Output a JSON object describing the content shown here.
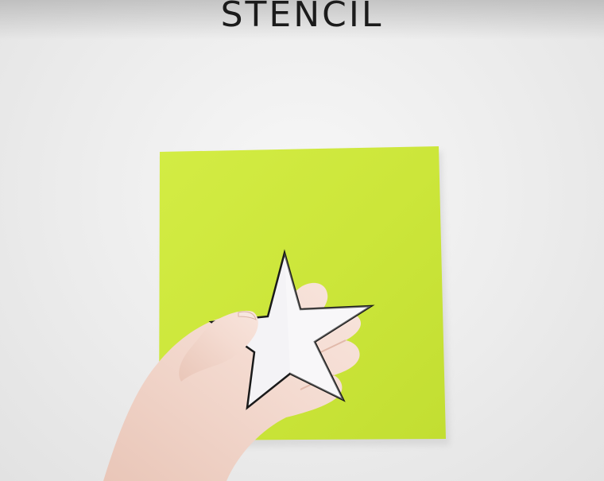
{
  "caption": {
    "text": "STENCIL"
  },
  "colors": {
    "background": "#ececec",
    "felt": "#cde83a",
    "star_fill": "#f4f3f6",
    "star_outline": "#1a1a1a",
    "skin": "#f3d7cc",
    "caption": "#1b1b1b"
  }
}
